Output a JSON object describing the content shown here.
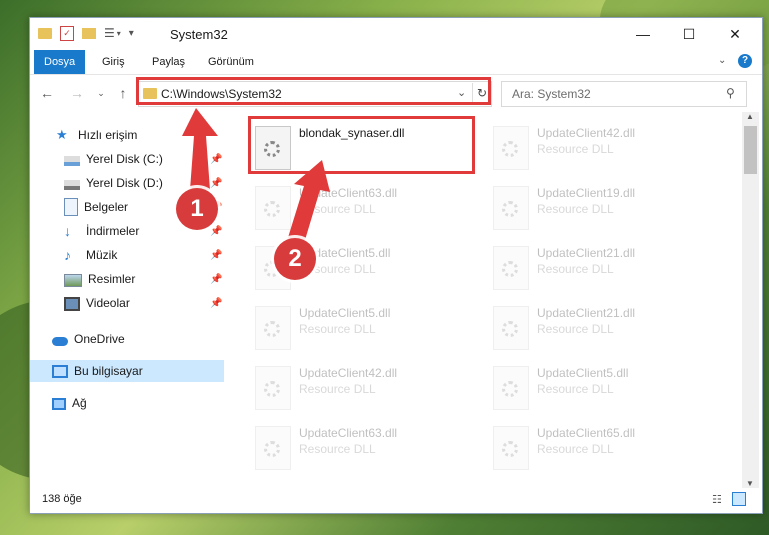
{
  "window": {
    "title": "System32",
    "controls": {
      "minimize": "—",
      "maximize": "☐",
      "close": "✕"
    }
  },
  "ribbon": {
    "tabs": [
      {
        "label": "Dosya",
        "active": true
      },
      {
        "label": "Giriş"
      },
      {
        "label": "Paylaş"
      },
      {
        "label": "Görünüm"
      }
    ],
    "expand_icon": "chevron-down-icon",
    "help_label": "?"
  },
  "address": {
    "path": "C:\\Windows\\System32"
  },
  "search": {
    "placeholder": "Ara: System32"
  },
  "sidebar": {
    "quick_access": "Hızlı erişim",
    "items": [
      {
        "label": "Yerel Disk (C:)",
        "icon": "drive-icon"
      },
      {
        "label": "Yerel Disk (D:)",
        "icon": "drive-icon"
      },
      {
        "label": "Belgeler",
        "icon": "documents-icon"
      },
      {
        "label": "İndirmeler",
        "icon": "download-icon"
      },
      {
        "label": "Müzik",
        "icon": "music-icon"
      },
      {
        "label": "Resimler",
        "icon": "pictures-icon"
      },
      {
        "label": "Videolar",
        "icon": "video-icon"
      }
    ],
    "onedrive": "OneDrive",
    "this_pc": "Bu bilgisayar",
    "network": "Ağ"
  },
  "files": {
    "highlighted": {
      "name": "blondak_synaser.dll"
    },
    "faded_left": [
      {
        "name": "UpdateClient63.dll",
        "type": "Resource DLL"
      },
      {
        "name": "UpdateClient5.dll",
        "type": "Resource DLL"
      },
      {
        "name": "UpdateClient5.dll",
        "type": "Resource DLL"
      },
      {
        "name": "UpdateClient42.dll",
        "type": "Resource DLL"
      },
      {
        "name": "UpdateClient63.dll",
        "type": "Resource DLL"
      }
    ],
    "faded_right": [
      {
        "name": "UpdateClient42.dll",
        "type": "Resource DLL"
      },
      {
        "name": "UpdateClient19.dll",
        "type": "Resource DLL"
      },
      {
        "name": "UpdateClient21.dll",
        "type": "Resource DLL"
      },
      {
        "name": "UpdateClient21.dll",
        "type": "Resource DLL"
      },
      {
        "name": "UpdateClient5.dll",
        "type": "Resource DLL"
      },
      {
        "name": "UpdateClient65.dll",
        "type": "Resource DLL"
      }
    ]
  },
  "status": {
    "item_count": "138 öğe"
  },
  "annotations": {
    "step1": "1",
    "step2": "2",
    "highlight_color": "#e03a3a"
  }
}
